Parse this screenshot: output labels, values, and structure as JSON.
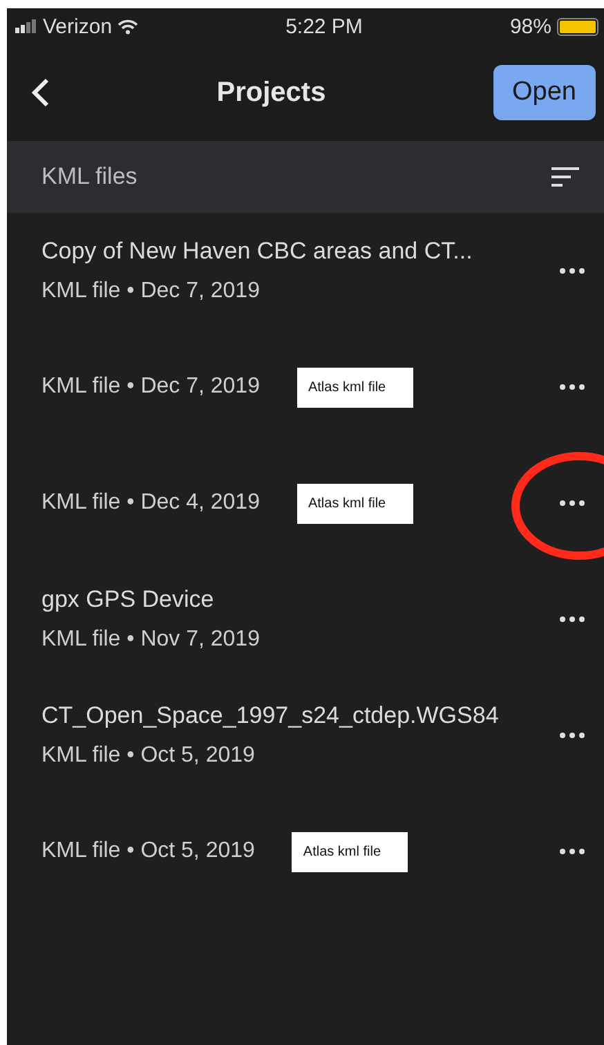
{
  "status_bar": {
    "carrier": "Verizon",
    "time": "5:22 PM",
    "battery": "98%"
  },
  "nav": {
    "title": "Projects",
    "action": "Open"
  },
  "section": {
    "title": "KML files"
  },
  "files": [
    {
      "kind": "titled",
      "title": "Copy of New Haven CBC areas and CT...",
      "subtitle": "KML file • Dec 7, 2019",
      "circled": false
    },
    {
      "kind": "noted",
      "subtitle": "KML file • Dec 7, 2019",
      "note": "Atlas kml file",
      "circled": false
    },
    {
      "kind": "noted",
      "subtitle": "KML file • Dec 4, 2019",
      "note": "Atlas kml file",
      "circled": true
    },
    {
      "kind": "titled",
      "title": "gpx GPS Device",
      "subtitle": "KML file • Nov 7, 2019",
      "circled": false
    },
    {
      "kind": "titled",
      "title": "CT_Open_Space_1997_s24_ctdep.WGS84",
      "subtitle": "KML file • Oct 5, 2019",
      "circled": false
    },
    {
      "kind": "noted",
      "subtitle": "KML file • Oct 5, 2019",
      "note": "Atlas kml file",
      "circled": false
    }
  ]
}
